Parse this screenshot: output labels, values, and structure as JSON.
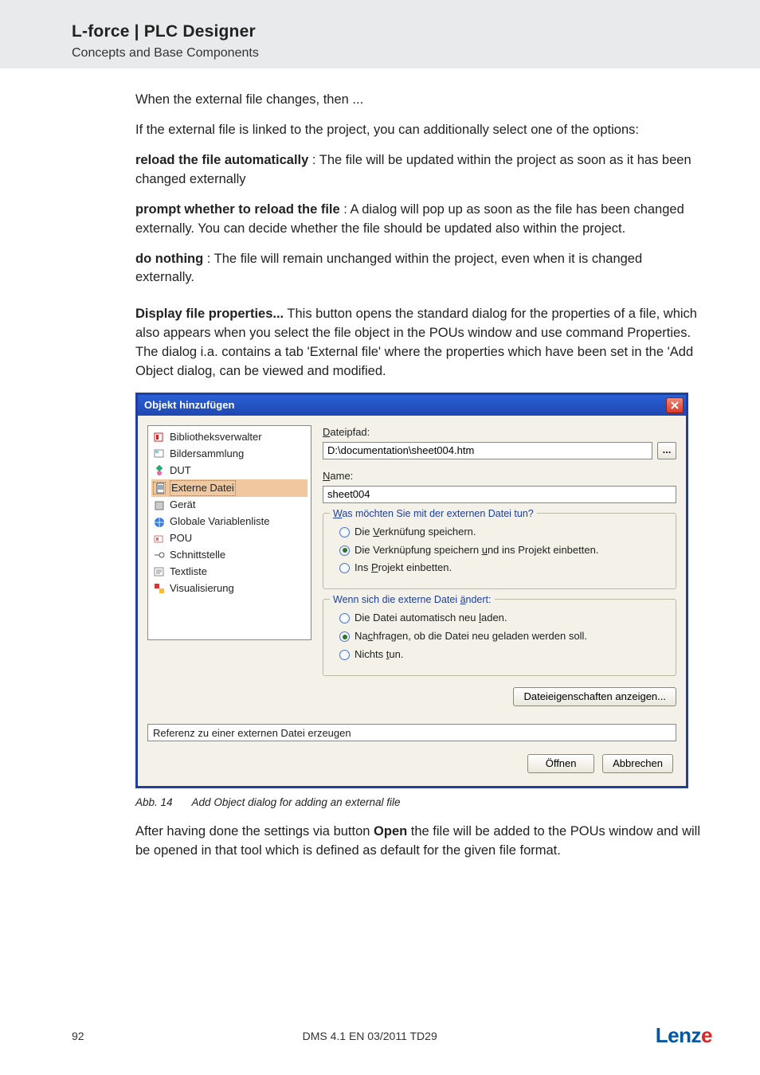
{
  "header": {
    "title": "L-force | PLC Designer",
    "subtitle": "Concepts and Base Components"
  },
  "body": {
    "p1": "When the external file changes, then ...",
    "p2": "If the external file is linked to the project, you can additionally select one of the options:",
    "p3_strong": "reload the file automatically",
    "p3_rest": " : The file will be updated within the project as soon as it has been changed externally",
    "p4_strong": "prompt whether to reload the file",
    "p4_rest": " : A dialog will pop up as soon as the file has been changed externally. You can decide whether the file  should be updated also within the project.",
    "p5_strong": "do nothing",
    "p5_rest": " : The file will remain unchanged within the project, even when it is changed externally.",
    "p6_strong": "Display file properties...",
    "p6_rest": " This button opens the standard dialog for the properties of a file, which also appears when you select the file object in the POUs window and use command Properties. The dialog i.a. contains a tab 'External file' where the properties which have been set in the 'Add Object dialog, can be viewed and modified.",
    "caption_no": "Abb. 14",
    "caption_text": "Add Object dialog for adding an external file",
    "p7_a": "After having done the settings via button ",
    "p7_b": "Open",
    "p7_c": " the file will be added to the POUs window and will be opened in that tool which is defined as default for the given file format."
  },
  "dialog": {
    "title": "Objekt hinzufügen",
    "list": [
      "Bibliotheksverwalter",
      "Bildersammlung",
      "DUT",
      "Externe Datei",
      "Gerät",
      "Globale Variablenliste",
      "POU",
      "Schnittstelle",
      "Textliste",
      "Visualisierung"
    ],
    "path_label": "Dateipfad:",
    "path_value": "D:\\documentation\\sheet004.htm",
    "browse": "...",
    "name_label": "Name:",
    "name_value": "sheet004",
    "group1_legend": "Was möchten Sie mit der externen Datei tun?",
    "g1_r1": "Die Verknüfung speichern.",
    "g1_r2": "Die Verknüpfung speichern und ins Projekt einbetten.",
    "g1_r3": "Ins Projekt einbetten.",
    "group2_legend": "Wenn sich die externe Datei ändert:",
    "g2_r1": "Die Datei automatisch neu laden.",
    "g2_r2": "Nachfragen, ob die Datei neu geladen werden soll.",
    "g2_r3": "Nichts tun.",
    "props_btn": "Dateieigenschaften anzeigen...",
    "status": "Referenz zu einer externen Datei erzeugen",
    "open": "Öffnen",
    "cancel": "Abbrechen"
  },
  "footer": {
    "page": "92",
    "doc": "DMS 4.1 EN 03/2011 TD29",
    "logo": "Lenze"
  }
}
